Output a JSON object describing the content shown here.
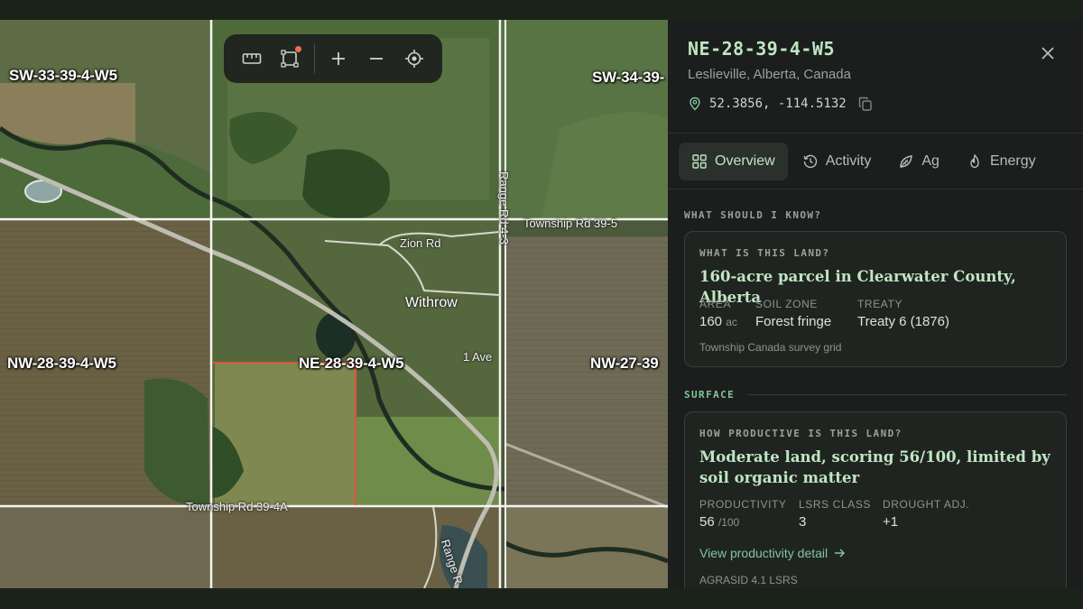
{
  "map": {
    "parcel_labels": [
      {
        "id": "sw33",
        "text": "SW-33-39-4-W5"
      },
      {
        "id": "sw34",
        "text": "SW-34-39-"
      },
      {
        "id": "nw28",
        "text": "NW-28-39-4-W5"
      },
      {
        "id": "ne28",
        "text": "NE-28-39-4-W5"
      },
      {
        "id": "nw27",
        "text": "NW-27-39"
      }
    ],
    "road_labels": {
      "township_395": "Township Rd 39-5",
      "zion_rd": "Zion Rd",
      "range_rd_43": "Range Rd 4-3",
      "first_ave": "1 Ave",
      "township_394a": "Township Rd 39-4A",
      "range_rd_bottom": "Range R"
    },
    "place_label": "Withrow",
    "toolbar": {
      "tools": [
        "ruler-icon",
        "draw-polygon-icon",
        "zoom-in-icon",
        "zoom-out-icon",
        "locate-icon"
      ],
      "badge_color": "#e8714f"
    },
    "selected_parcel_color": "#e0553a"
  },
  "panel": {
    "title": "NE-28-39-4-W5",
    "location": "Leslieville, Alberta, Canada",
    "coordinates": "52.3856, -114.5132",
    "tabs": [
      {
        "label": "Overview",
        "icon": "grid-icon",
        "active": true
      },
      {
        "label": "Activity",
        "icon": "history-icon",
        "active": false
      },
      {
        "label": "Ag",
        "icon": "leaf-icon",
        "active": false
      },
      {
        "label": "Energy",
        "icon": "flame-icon",
        "active": false
      }
    ],
    "section_know": "WHAT SHOULD I KNOW?",
    "land_card": {
      "question": "WHAT IS THIS LAND?",
      "headline": "160-acre parcel in Clearwater County, Alberta",
      "stats": [
        {
          "label": "AREA",
          "value": "160",
          "unit": "ac"
        },
        {
          "label": "SOIL ZONE",
          "value": "Forest fringe",
          "unit": ""
        },
        {
          "label": "TREATY",
          "value": "Treaty 6 (1876)",
          "unit": ""
        }
      ],
      "note": "Township Canada survey grid"
    },
    "section_surface": "SURFACE",
    "productivity_card": {
      "question": "HOW PRODUCTIVE IS THIS LAND?",
      "headline": "Moderate land, scoring 56/100, limited by soil organic matter",
      "stats": [
        {
          "label": "PRODUCTIVITY",
          "value": "56",
          "unit": "/100"
        },
        {
          "label": "LSRS CLASS",
          "value": "3",
          "unit": ""
        },
        {
          "label": "DROUGHT ADJ.",
          "value": "+1",
          "unit": ""
        }
      ],
      "link": "View productivity detail",
      "note": "AGRASID 4.1 LSRS"
    },
    "accent_color": "#bfe6c2",
    "link_color": "#7dc79a"
  }
}
